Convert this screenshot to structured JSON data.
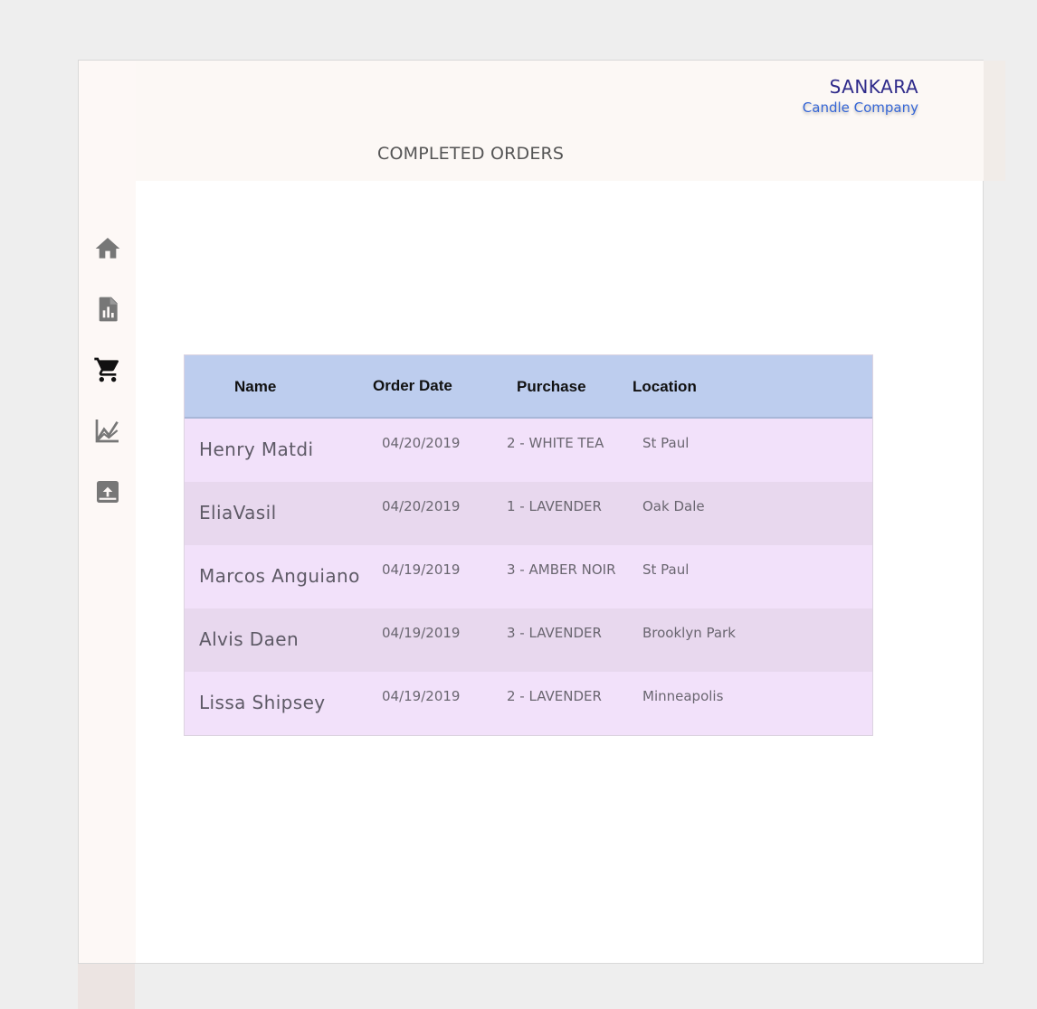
{
  "brand": {
    "name": "SANKARA",
    "subtitle": "Candle Company"
  },
  "page": {
    "title": "COMPLETED ORDERS"
  },
  "sidebar": {
    "items": [
      {
        "icon": "home-icon",
        "active": false
      },
      {
        "icon": "report-icon",
        "active": false
      },
      {
        "icon": "cart-icon",
        "active": true
      },
      {
        "icon": "chart-icon",
        "active": false
      },
      {
        "icon": "upload-icon",
        "active": false
      }
    ]
  },
  "table": {
    "columns": [
      "Name",
      "Order Date",
      "Purchase",
      "Location"
    ],
    "rows": [
      {
        "name": "Henry Matdi",
        "date": "04/20/2019",
        "purchase": "2 - WHITE TEA",
        "location": "St Paul"
      },
      {
        "name": "EliaVasil",
        "date": "04/20/2019",
        "purchase": "1 - LAVENDER",
        "location": "Oak Dale"
      },
      {
        "name": "Marcos Anguiano",
        "date": "04/19/2019",
        "purchase": "3 - AMBER NOIR",
        "location": "St Paul"
      },
      {
        "name": "Alvis Daen",
        "date": "04/19/2019",
        "purchase": "3 - LAVENDER",
        "location": "Brooklyn Park"
      },
      {
        "name": "Lissa Shipsey",
        "date": "04/19/2019",
        "purchase": "2 - LAVENDER",
        "location": "Minneapolis"
      }
    ]
  },
  "colors": {
    "brand": "#2e2a8a",
    "brand_sub": "#3566d6",
    "table_header": "#bdcdee",
    "row_odd": "#f2e1fa",
    "row_even": "#e8d8ee"
  }
}
